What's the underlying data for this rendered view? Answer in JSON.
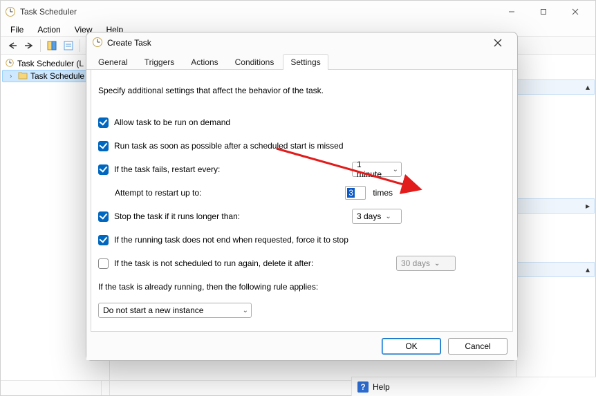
{
  "main": {
    "title": "Task Scheduler",
    "menubar": [
      "File",
      "Action",
      "View",
      "Help"
    ],
    "tree": {
      "root": "Task Scheduler (L",
      "child": "Task Schedule"
    },
    "help": "Help"
  },
  "dialog": {
    "title": "Create Task",
    "tabs": [
      "General",
      "Triggers",
      "Actions",
      "Conditions",
      "Settings"
    ],
    "active_tab": 4,
    "intro": "Specify additional settings that affect the behavior of the task.",
    "allow_on_demand": "Allow task to be run on demand",
    "run_asap": "Run task as soon as possible after a scheduled start is missed",
    "restart_every_label": "If the task fails, restart every:",
    "restart_every_value": "1 minute",
    "attempt_label": "Attempt to restart up to:",
    "attempt_value": "3",
    "attempt_suffix": "times",
    "stop_longer_label": "Stop the task if it runs longer than:",
    "stop_longer_value": "3 days",
    "force_stop": "If the running task does not end when requested, force it to stop",
    "delete_after_label": "If the task is not scheduled to run again, delete it after:",
    "delete_after_value": "30 days",
    "rule_label": "If the task is already running, then the following rule applies:",
    "rule_value": "Do not start a new instance",
    "ok": "OK",
    "cancel": "Cancel"
  }
}
